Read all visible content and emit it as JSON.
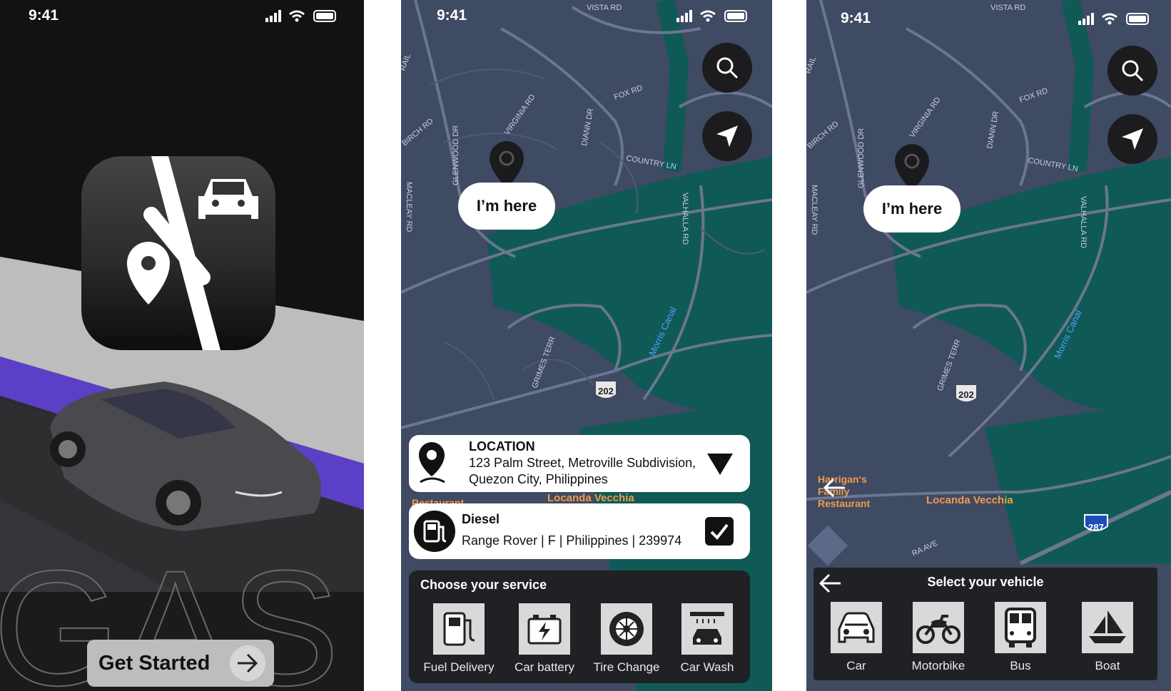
{
  "status_bar": {
    "time": "9:41"
  },
  "splash": {
    "background_letters": "GAS",
    "get_started_label": "Get Started",
    "colors": {
      "accent": "#5b3fc7",
      "dark": "#121214",
      "road": "#bdbdbd"
    }
  },
  "service_screen": {
    "pin_label": "I’m here",
    "location": {
      "title": "LOCATION",
      "line1": "123 Palm Street, Metroville Subdivision,",
      "line2": "Quezon City, Philippines"
    },
    "fuel": {
      "title": "Diesel",
      "details": "Range Rover | F | Philippines | 239974"
    },
    "services_title": "Choose your service",
    "services": [
      {
        "label": "Fuel Delivery",
        "icon": "fuel-pump-icon"
      },
      {
        "label": "Car battery",
        "icon": "battery-icon"
      },
      {
        "label": "Tire Change",
        "icon": "tire-icon"
      },
      {
        "label": "Car Wash",
        "icon": "car-wash-icon"
      }
    ],
    "map_labels": {
      "vista": "VISTA RD",
      "fox": "FOX RD",
      "country": "COUNTRY LN",
      "virginia": "VIRGINIA RD",
      "birch": "BIRCH RD",
      "glenwood": "GLENWOOD DR",
      "diann": "DIANN DR",
      "valhalla": "VALHALLA RD",
      "grimes": "GRIMES TERR",
      "canal": "Morris Canal",
      "route": "202",
      "rail": "RAIL",
      "macleay": "MACLEAY RD",
      "poi_locanda": "Locanda Vecchia",
      "poi_restaurant": "Restaurant"
    }
  },
  "vehicle_screen": {
    "pin_label": "I’m here",
    "panel_title": "Select your vehicle",
    "vehicles": [
      {
        "label": "Car",
        "icon": "car-icon"
      },
      {
        "label": "Motorbike",
        "icon": "motorbike-icon"
      },
      {
        "label": "Bus",
        "icon": "bus-icon"
      },
      {
        "label": "Boat",
        "icon": "boat-icon"
      }
    ],
    "map_labels": {
      "harrigans": "Harrigan's Family Restaurant",
      "harrigans_1": "Harrigan's",
      "harrigans_2": "Family",
      "harrigans_3": "Restaurant",
      "poi_locanda": "Locanda Vecchia",
      "route": "202",
      "interstate": "287",
      "ave": "RA AVE"
    }
  }
}
